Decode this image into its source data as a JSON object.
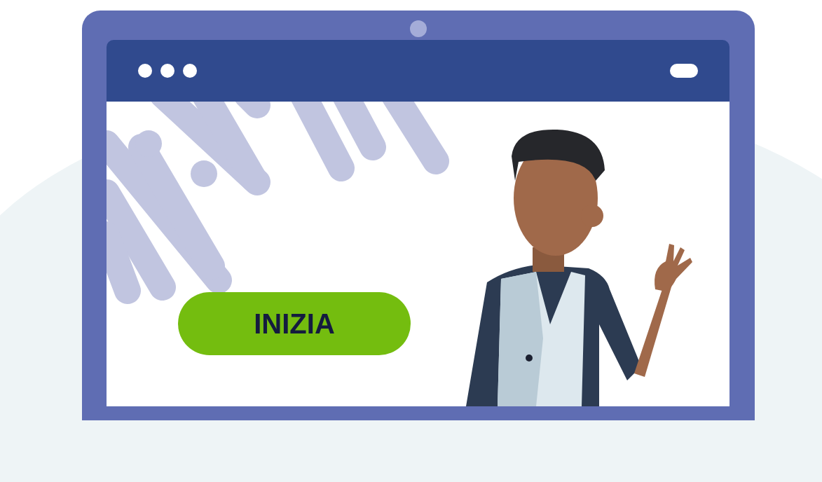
{
  "button": {
    "label": "INIZIA"
  }
}
